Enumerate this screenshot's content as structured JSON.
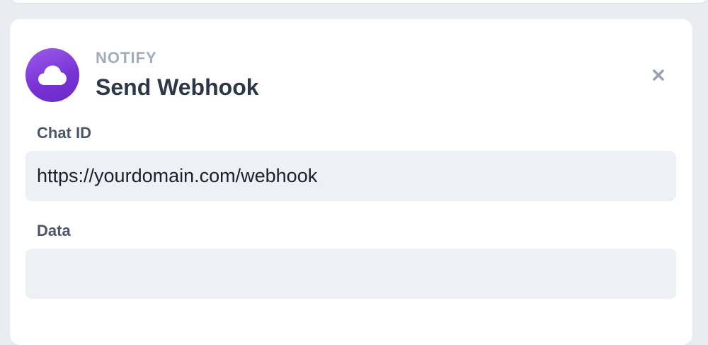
{
  "step": {
    "category": "NOTIFY",
    "title": "Send Webhook",
    "icon": "cloud-icon",
    "close_icon": "close-icon",
    "accent_color": "#7a34d6"
  },
  "fields": {
    "chat_id": {
      "label": "Chat ID",
      "value": "https://yourdomain.com/webhook"
    },
    "data": {
      "label": "Data",
      "value": ""
    }
  }
}
